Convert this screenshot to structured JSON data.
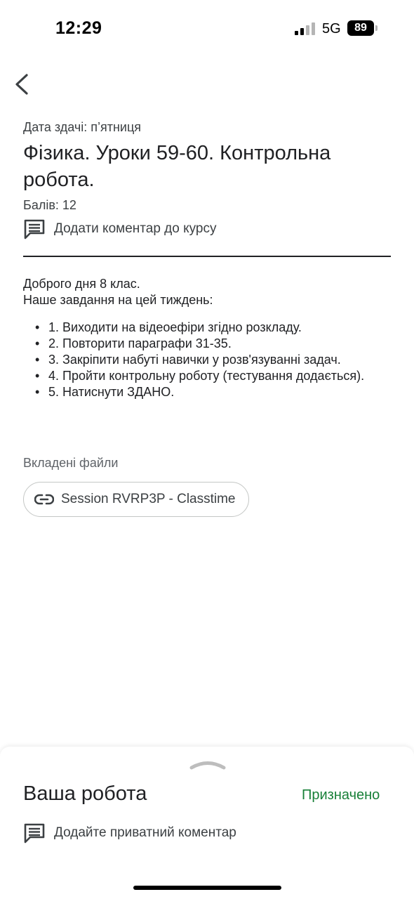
{
  "status_bar": {
    "time": "12:29",
    "network": "5G",
    "battery": "89"
  },
  "assignment": {
    "due": "Дата здачі: п’ятниця",
    "title": "Фізика. Уроки 59-60. Контрольна робота.",
    "points": "Балів: 12",
    "class_comment_label": "Додати коментар до курсу",
    "greeting": "Доброго дня 8 клас.",
    "intro": "Наше завдання на цей тиждень:",
    "tasks": [
      "1. Виходити на відеоефіри згідно розкладу.",
      "2. Повторити параграфи 31-35.",
      "3. Закріпити набуті навички у розв'язуванні задач.",
      "4. Пройти контрольну роботу (тестування додається).",
      "5. Натиснути ЗДАНО."
    ],
    "attachments_header": "Вкладені файли",
    "attachment_label": "Session RVRP3P - Classtime"
  },
  "your_work": {
    "title": "Ваша робота",
    "status": "Призначено",
    "private_comment_label": "Додайте приватний коментар"
  },
  "colors": {
    "text": "#202124",
    "secondary": "#3c4043",
    "muted": "#5f6368",
    "status_green": "#188038",
    "chip_border": "#c4c7c5"
  },
  "icons": {
    "back": "chevron-left-icon",
    "class_comment": "comment-icon",
    "attachment": "link-icon",
    "sheet_handle": "chevron-up-icon",
    "private_comment": "comment-icon"
  }
}
